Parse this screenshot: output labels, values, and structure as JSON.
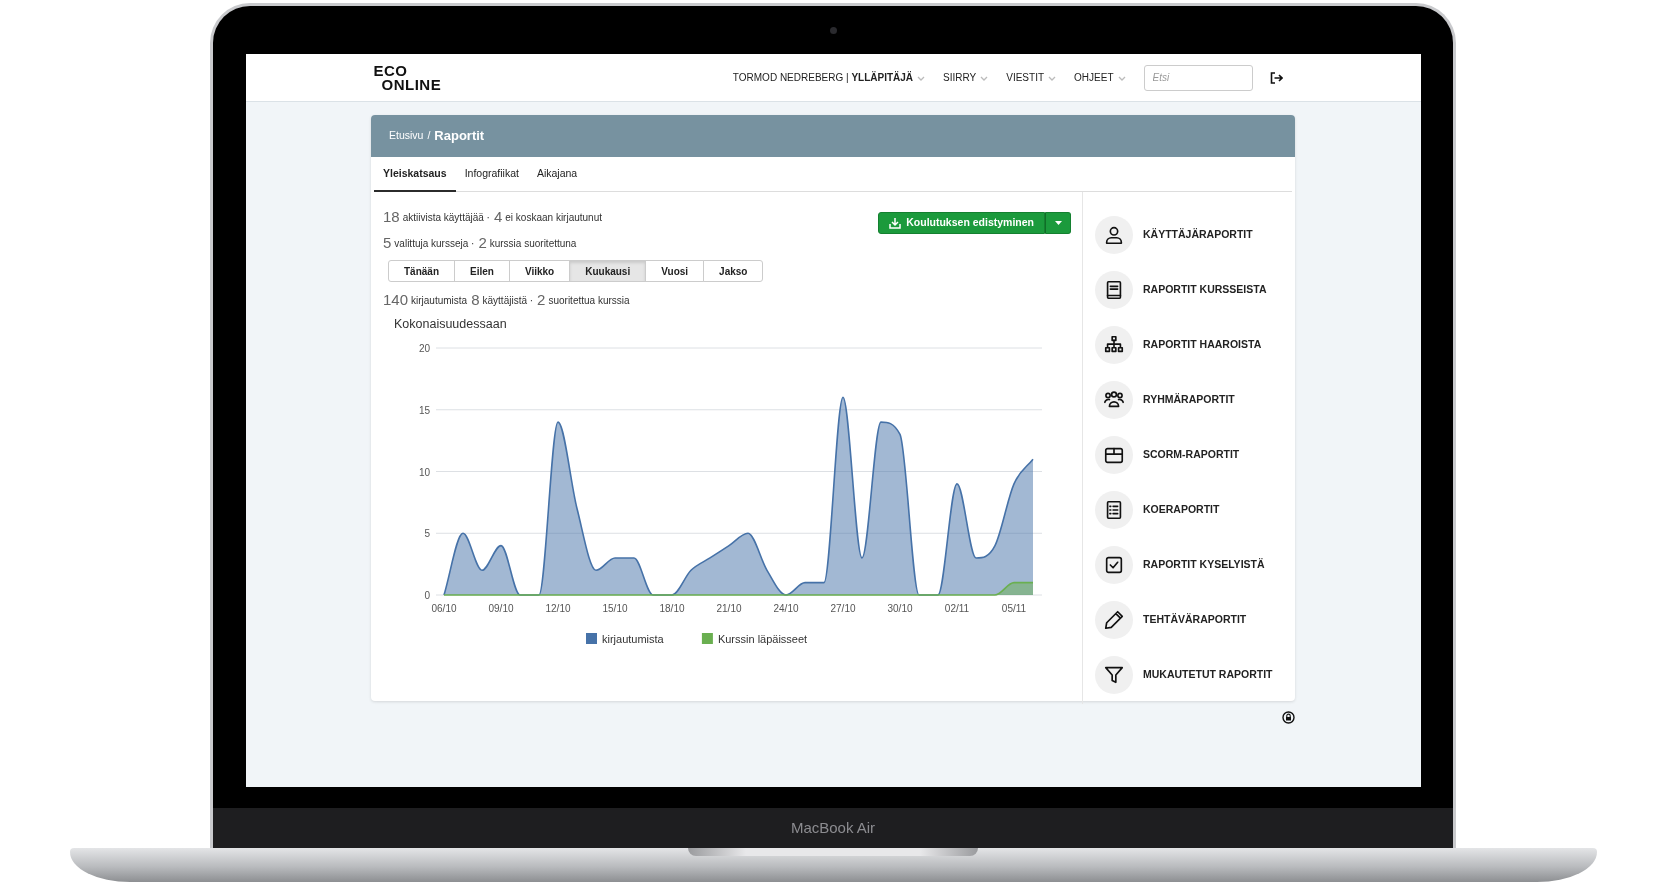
{
  "device": {
    "label": "MacBook Air"
  },
  "header": {
    "logo": {
      "line_1": "ECO",
      "line_2": "ONLINE"
    },
    "nav": [
      {
        "label": "TORMOD NEDREBERG | **YLLÄPITÄJÄ**"
      },
      {
        "label": "SIIRRY"
      },
      {
        "label": "VIESTIT"
      },
      {
        "label": "OHJEET"
      }
    ],
    "search": {
      "placeholder": "Etsi"
    }
  },
  "breadcrumb": {
    "items": [
      "Etusivu",
      "Raportit"
    ],
    "separator": "/"
  },
  "tabs": [
    {
      "label": "Yleiskatsaus",
      "selected": true
    },
    {
      "label": "Infografiikat",
      "selected": false
    },
    {
      "label": "Aikajana",
      "selected": false
    }
  ],
  "stats": [
    [
      {
        "number": "18",
        "label": "aktiivista käyttäjää ·"
      },
      {
        "number": "4",
        "label": "ei koskaan kirjautunut"
      }
    ],
    [
      {
        "number": "5",
        "label": "valittuja kursseja ·"
      },
      {
        "number": "2",
        "label": "kurssia suoritettuna"
      }
    ]
  ],
  "export_button": {
    "label": "Koulutuksen edistyminen"
  },
  "periods": [
    {
      "label": "Tänään",
      "selected": false
    },
    {
      "label": "Eilen",
      "selected": false
    },
    {
      "label": "Viikko",
      "selected": false
    },
    {
      "label": "Kuukausi",
      "selected": true
    },
    {
      "label": "Vuosi",
      "selected": false
    },
    {
      "label": "Jakso",
      "selected": false
    }
  ],
  "summary": [
    {
      "number": "140",
      "label": "kirjautumista"
    },
    {
      "number": "8",
      "label": "käyttäjistä ·"
    },
    {
      "number": "2",
      "label": "suoritettua kurssia"
    }
  ],
  "chart": {
    "chart_data": {
      "type": "area",
      "title": "Kokonaisuudessaan",
      "categories": [
        "06/10",
        null,
        null,
        "09/10",
        null,
        null,
        "12/10",
        null,
        null,
        "15/10",
        null,
        null,
        "18/10",
        null,
        null,
        "21/10",
        null,
        null,
        "24/10",
        null,
        null,
        "27/10",
        null,
        null,
        "30/10",
        null,
        null,
        "02/11",
        null,
        null,
        "05/11",
        null
      ],
      "grid": true,
      "legend": "bottom",
      "series": [
        {
          "name": "kirjautumista",
          "color": "#4672a8",
          "values": [
            0,
            5,
            2,
            4,
            0,
            0,
            14,
            7,
            2,
            3,
            3,
            0,
            0,
            2,
            3,
            4,
            5,
            2,
            0,
            1,
            1,
            16,
            3,
            14,
            13,
            0,
            0,
            9,
            3,
            4,
            9,
            11
          ]
        },
        {
          "name": "Kurssin läpäisseet",
          "color": "#6aaf50",
          "values": [
            0,
            0,
            0,
            0,
            0,
            0,
            0,
            0,
            0,
            0,
            0,
            0,
            0,
            0,
            0,
            0,
            0,
            0,
            0,
            0,
            0,
            0,
            0,
            0,
            0,
            0,
            0,
            0,
            0,
            0,
            1,
            1
          ]
        }
      ],
      "ylim": [
        0,
        20
      ],
      "yticks": [
        0,
        5,
        10,
        15,
        20
      ]
    }
  },
  "reports": [
    {
      "label": "KÄYTTÄJÄRAPORTIT"
    },
    {
      "label": "RAPORTIT KURSSEISTA"
    },
    {
      "label": "RAPORTIT HAAROISTA"
    },
    {
      "label": "RYHMÄRAPORTIT"
    },
    {
      "label": "SCORM-RAPORTIT"
    },
    {
      "label": "KOERAPORTIT"
    },
    {
      "label": "RAPORTIT KYSELYISTÄ"
    },
    {
      "label": "TEHTÄVÄRAPORTIT"
    },
    {
      "label": "MUKAUTETUT RAPORTIT"
    }
  ]
}
